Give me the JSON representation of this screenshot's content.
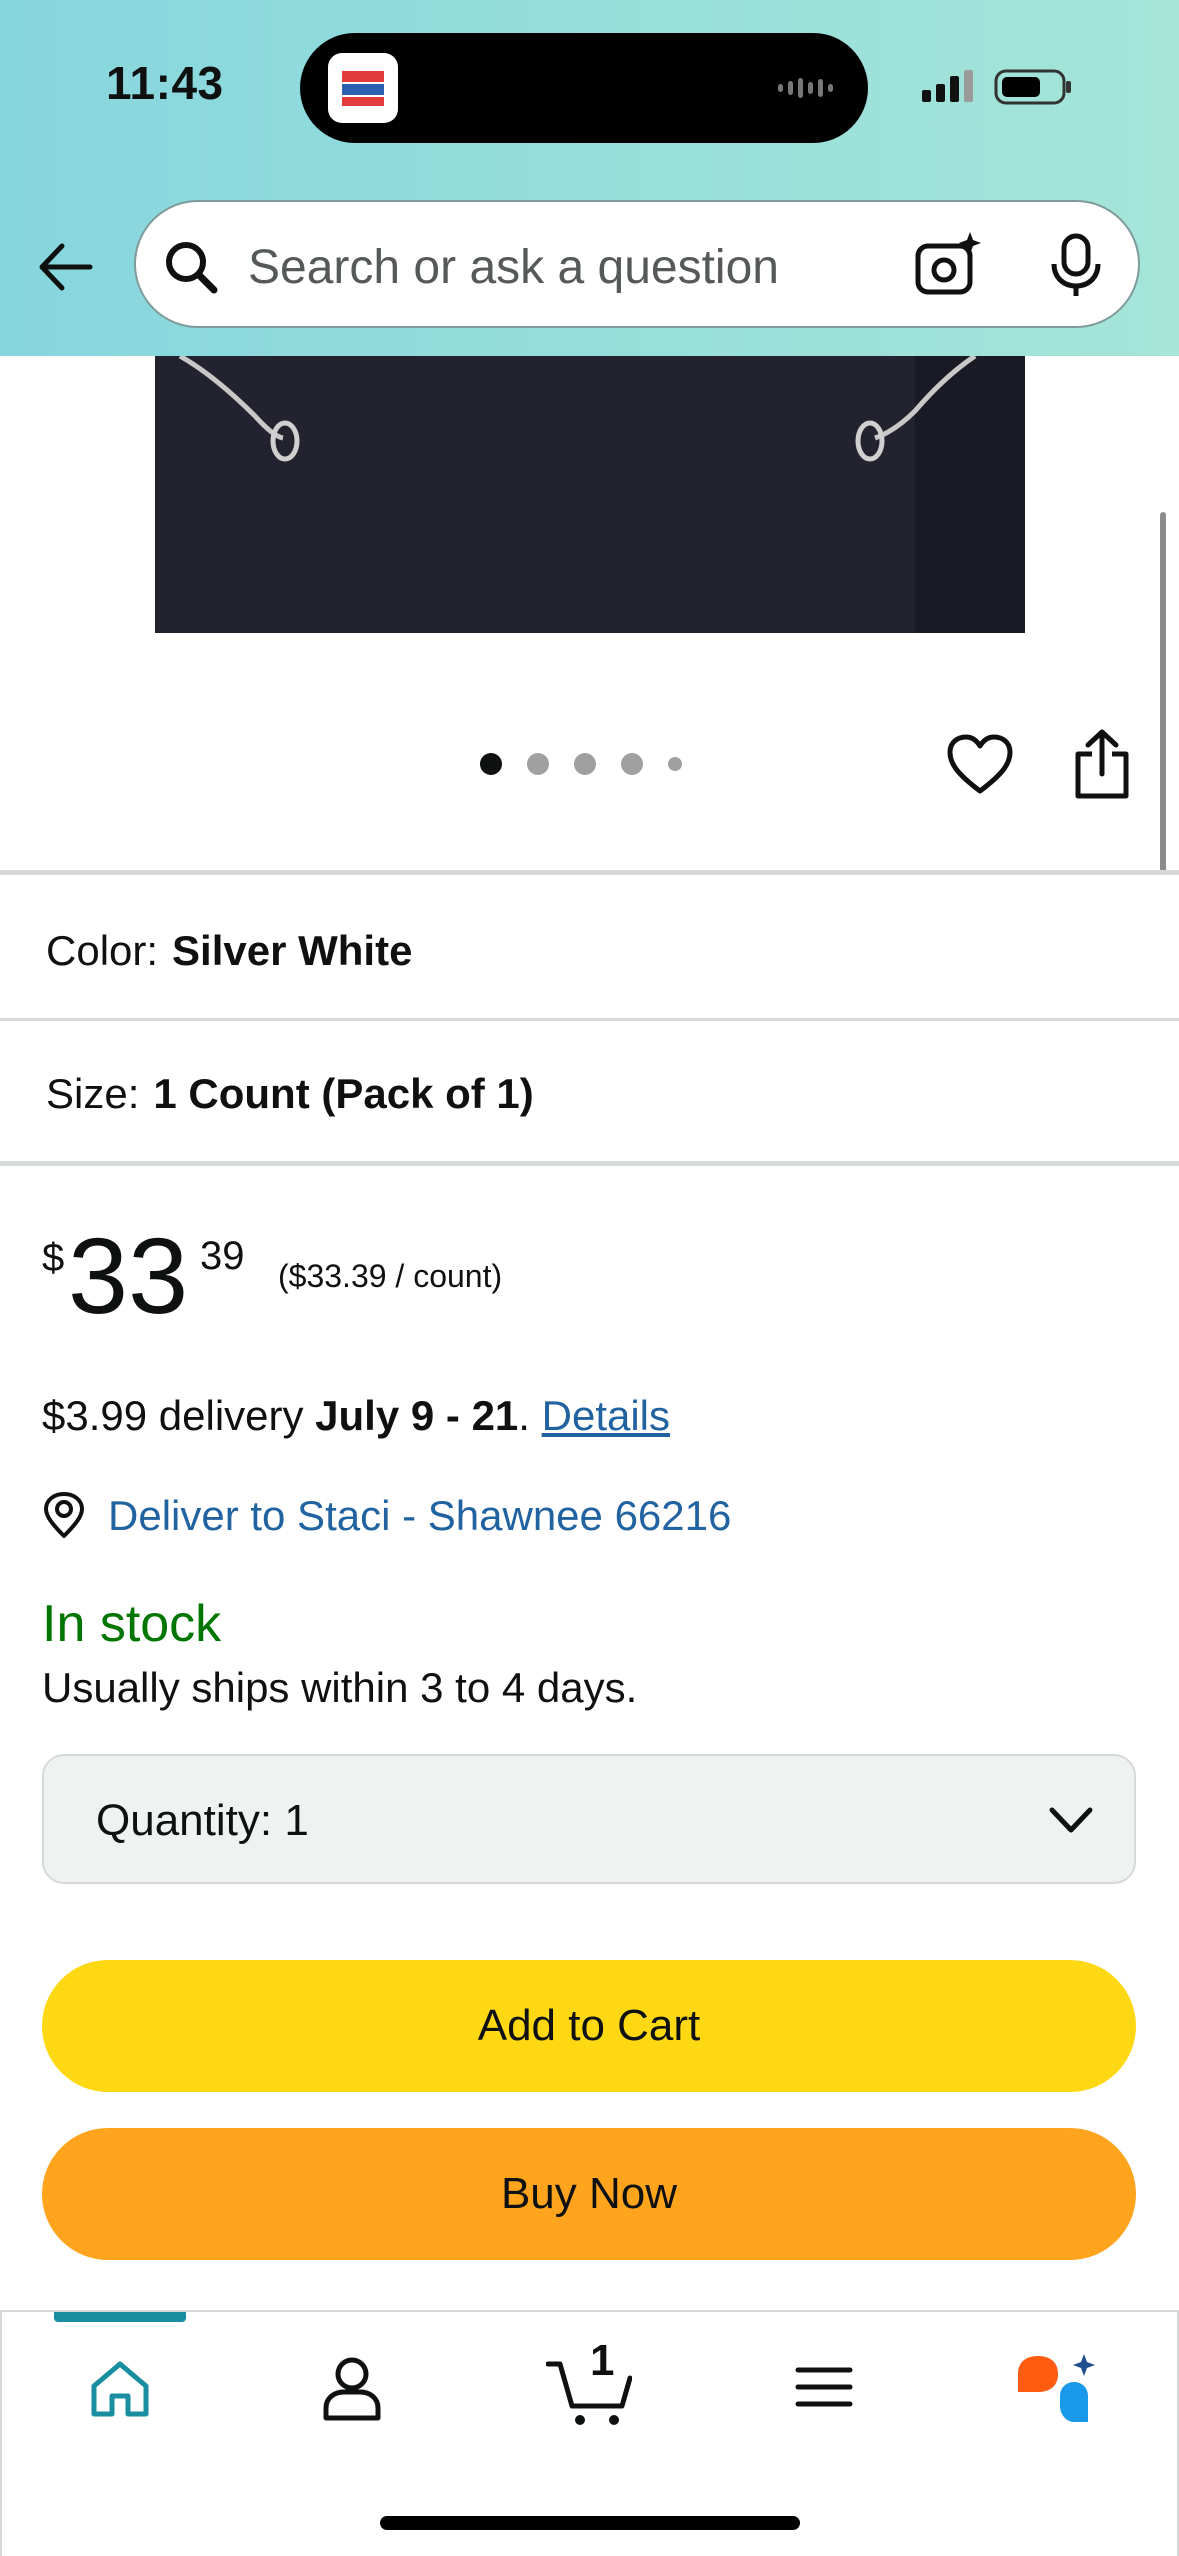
{
  "status_bar": {
    "time": "11:43"
  },
  "header": {
    "search_placeholder": "Search or ask a question",
    "gradient_start": "#86d6de",
    "gradient_end": "#a6e5d8"
  },
  "gallery": {
    "image_count": 5,
    "active_index": 0
  },
  "variants": {
    "color_label": "Color:",
    "color_value": "Silver White",
    "size_label": "Size:",
    "size_value": "1 Count (Pack of 1)"
  },
  "price": {
    "symbol": "$",
    "whole": "33",
    "fraction": "39",
    "unit_price": "($33.39 / count)"
  },
  "delivery": {
    "fee": "$3.99 delivery",
    "dates": "July 9 - 21",
    "separator": ".",
    "details_link": "Details",
    "deliver_to": "Deliver to Staci - Shawnee 66216"
  },
  "availability": {
    "status": "In stock",
    "ships_note": "Usually ships within 3 to 4 days.",
    "status_color": "#007600"
  },
  "quantity": {
    "label": "Quantity:",
    "value": "1"
  },
  "actions": {
    "add_to_cart": "Add to Cart",
    "buy_now": "Buy Now",
    "add_to_cart_color": "#ffd814",
    "buy_now_color": "#ffa41c"
  },
  "bottom_nav": {
    "items": [
      "home-icon",
      "account-icon",
      "cart-icon",
      "menu-icon",
      "rufus-assistant-icon"
    ],
    "active": "home-icon",
    "cart_count": "1",
    "accent_color": "#1a8ea1"
  }
}
